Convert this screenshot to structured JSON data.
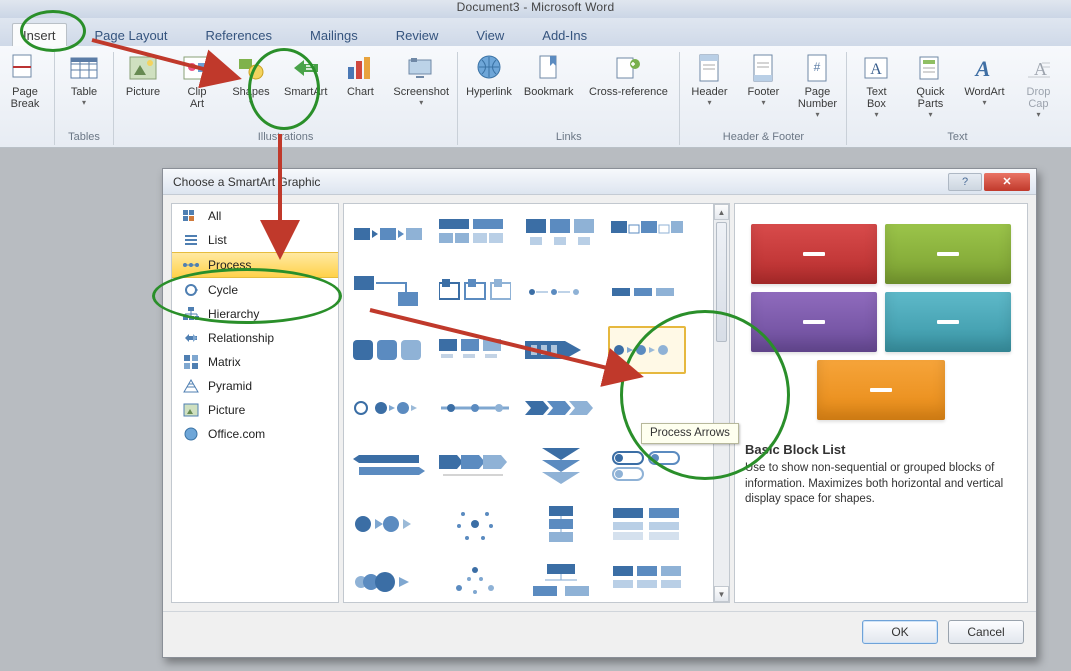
{
  "window": {
    "title": "Document3 - Microsoft Word"
  },
  "tabs": {
    "insert": "Insert",
    "pagelayout": "Page Layout",
    "references": "References",
    "mailings": "Mailings",
    "review": "Review",
    "view": "View",
    "addins": "Add-Ins"
  },
  "ribbon": {
    "pagebreak": "Page\nBreak",
    "table": "Table",
    "picture": "Picture",
    "clipart": "Clip\nArt",
    "shapes": "Shapes",
    "smartart": "SmartArt",
    "chart": "Chart",
    "screenshot": "Screenshot",
    "hyperlink": "Hyperlink",
    "bookmark": "Bookmark",
    "crossref": "Cross-reference",
    "header": "Header",
    "footer": "Footer",
    "pagenumber": "Page\nNumber",
    "textbox": "Text\nBox",
    "quickparts": "Quick\nParts",
    "wordart": "WordArt",
    "dropcap": "Drop\nCap",
    "groups": {
      "tables": "Tables",
      "illustrations": "Illustrations",
      "links": "Links",
      "headerfooter": "Header & Footer",
      "text": "Text"
    }
  },
  "dialog": {
    "title": "Choose a SmartArt Graphic",
    "categories": {
      "all": "All",
      "list": "List",
      "process": "Process",
      "cycle": "Cycle",
      "hierarchy": "Hierarchy",
      "relationship": "Relationship",
      "matrix": "Matrix",
      "pyramid": "Pyramid",
      "picture": "Picture",
      "officecom": "Office.com"
    },
    "tooltip": "Process Arrows",
    "preview": {
      "title": "Basic Block List",
      "desc": "Use to show non-sequential or grouped blocks of information. Maximizes both horizontal and vertical display space for shapes."
    },
    "buttons": {
      "ok": "OK",
      "cancel": "Cancel"
    }
  }
}
